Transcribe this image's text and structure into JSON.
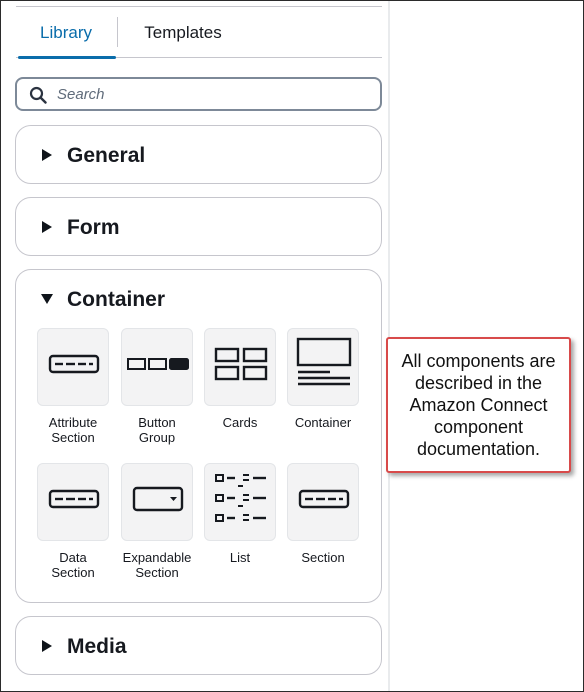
{
  "tabs": {
    "library_label": "Library",
    "templates_label": "Templates"
  },
  "search": {
    "placeholder": "Search",
    "value": ""
  },
  "sections": {
    "general": {
      "title": "General",
      "expanded": false
    },
    "form": {
      "title": "Form",
      "expanded": false
    },
    "container": {
      "title": "Container",
      "expanded": true,
      "items": [
        {
          "label": "Attribute\nSection",
          "icon": "attribute-section-icon"
        },
        {
          "label": "Button\nGroup",
          "icon": "button-group-icon"
        },
        {
          "label": "Cards",
          "icon": "cards-icon"
        },
        {
          "label": "Container",
          "icon": "container-icon"
        },
        {
          "label": "Data\nSection",
          "icon": "data-section-icon"
        },
        {
          "label": "Expandable\nSection",
          "icon": "expandable-section-icon"
        },
        {
          "label": "List",
          "icon": "list-icon"
        },
        {
          "label": "Section",
          "icon": "section-icon"
        }
      ]
    },
    "media": {
      "title": "Media",
      "expanded": false
    }
  },
  "callout": {
    "text": "All components are described in the Amazon Connect component documentation."
  },
  "colors": {
    "accent": "#0a6dab",
    "callout_border": "#d84a4a",
    "tile_bg": "#f3f3f4"
  }
}
